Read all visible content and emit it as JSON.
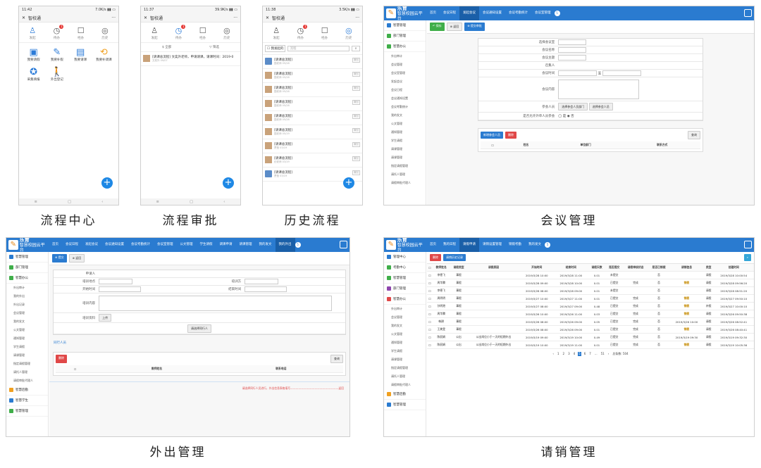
{
  "captions": {
    "p1": "流程中心",
    "p2": "流程审批",
    "p3": "历史流程",
    "p4": "会议管理",
    "p5": "外出管理",
    "p6": "请销管理"
  },
  "phone": {
    "title": "智校通",
    "more": "···",
    "close": "✕",
    "time1": "11:42",
    "time2": "11:37",
    "time3": "11:38",
    "status1": "7.0K/s ▮▮ ▭",
    "status2": "39.9K/s ▮▮ ▭",
    "status3": "3.5K/s ▮▮ ▭",
    "icons": [
      "发起",
      "待办",
      "经办",
      "历史"
    ],
    "badge": "1",
    "apps": [
      "我要请假",
      "我要补假",
      "我要请课",
      "我要补调课",
      "采集填报",
      "外出登记"
    ],
    "filter_all": "全部",
    "filter_sort": "筛选",
    "approval_item": "[请课总流程] 文奕外老师，申请请课，请课时间：2019-0",
    "approval_sub": "文奕外 09/07",
    "check_all": "我发起的",
    "search_ph": "流程",
    "history": [
      {
        "t": "[请课总流程]",
        "s": "国老师 05/28",
        "a": "撤回"
      },
      {
        "t": "[请课总流程]",
        "s": "国老师 05/28",
        "a": "撤回"
      },
      {
        "t": "[请课总流程]",
        "s": "国老师 05/28",
        "a": "撤回"
      },
      {
        "t": "[请课总流程]",
        "s": "国老师 05/28",
        "a": "撤回"
      },
      {
        "t": "[请课总流程]",
        "s": "国老师 05/28",
        "a": "撤回"
      },
      {
        "t": "[请课总流程]",
        "s": "国老师 05/19",
        "a": "撤回"
      },
      {
        "t": "[请课总流程]",
        "s": "贾莹 03/19",
        "a": "撤回"
      },
      {
        "t": "[请课总流程]",
        "s": "纪老师 03/19",
        "a": "撤回"
      },
      {
        "t": "[请课总流程]",
        "s": "贾莹 03/19",
        "a": "撤回"
      }
    ]
  },
  "web": {
    "logo": "乐育",
    "logo_sub": "智慧校园云平台",
    "nav4": [
      "首页",
      "会议日程",
      "发起会议",
      "会议通知设置",
      "会议考勤统计",
      "会议室管理"
    ],
    "nav5": [
      "首页",
      "会议日程",
      "发起会议",
      "会议通知设置",
      "会议考勤统计",
      "会议室管理",
      "公文管理",
      "学生请假",
      "调课申请",
      "请课管理",
      "我的发文",
      "我的外出"
    ],
    "nav6": [
      "首页",
      "我的日程",
      "请假申请",
      "请销设置管理",
      "销假考勤",
      "我的发文"
    ],
    "nav_bubble": "5",
    "side4": [
      "智慧管理",
      "部门管理",
      "智慧办公",
      "外出审计",
      "会议管理",
      "会议室管理",
      "发起会议",
      "会议日程",
      "会议通知设置",
      "会议考勤统计",
      "我的发文",
      "公文管理",
      "通知管理",
      "学生请假",
      "请课管理",
      "请课管理",
      "指定请假管理",
      "请托人管理",
      "请假审批代理人"
    ],
    "toolbar4": {
      "save": "保存",
      "back": "返回",
      "submit": "提交审批"
    },
    "form4": [
      "选择会议室",
      "会议名称",
      "会议主题",
      "召集人",
      "会议时间",
      "会议内容",
      "参会人员",
      "是否允许外单人员参会"
    ],
    "to": "至",
    "pick_dept": "选择参会人员部门",
    "pick_person": "选择参会人员",
    "yes": "是",
    "no": "否",
    "add_btn": "新增参会人员",
    "del_btn": "删除",
    "search_btn": "查询",
    "cols4": [
      "姓名",
      "单位部门",
      "联系方式"
    ],
    "toolbar5": {
      "submit": "提交",
      "back": "返回"
    },
    "form5": [
      "申请人",
      "培训地点",
      "培训方",
      "开始时间",
      "结束时间",
      "培训内容",
      "培训资料"
    ],
    "upload": "上传",
    "choose_fellow": "请选择同行人",
    "fellow_tab": "同行人员",
    "cols5": [
      "教师姓名",
      "联系电话"
    ],
    "footer5": "请选择同行人员进行，外出信息表格填写——————————————————返回",
    "side5": [
      "智慧管理",
      "部门管理",
      "智慧办公",
      "外出审计",
      "我的外出",
      "外出记录",
      "会议管理",
      "我的发文",
      "公文管理",
      "通知管理",
      "学生请假",
      "请课管理",
      "指定请假管理",
      "请托人管理",
      "请假审批代理人",
      "智慧后勤",
      "智慧学生",
      "智慧管理"
    ],
    "side6": [
      "管理中心",
      "考勤中心",
      "智慧管理",
      "部门管理",
      "智慧办公",
      "外出审计",
      "会议管理",
      "我的发文",
      "公文管理",
      "通知管理",
      "学生请假",
      "请课管理",
      "指定请假管理",
      "请托人管理",
      "请假审批代理人",
      "智慧后勤",
      "智慧管理"
    ],
    "toolbar6": {
      "del": "删除",
      "clear": "请销历史记录"
    },
    "cols6": [
      "教师姓名",
      "请假类型",
      "请假原因",
      "开始时间",
      "结束时间",
      "请假天数",
      "是否提交",
      "请假审核状态",
      "是否已销假",
      "请销信息",
      "类型",
      "创建时间"
    ],
    "rows6": [
      [
        "李德飞",
        "事假",
        "",
        "2019/3/28 10:00",
        "2019/3/28 11:00",
        "0.01",
        "未提交",
        "",
        "否",
        "",
        "请假",
        "2019/3/28 10:00:54"
      ],
      [
        "周华腾",
        "事假",
        "",
        "2019/3/28 09:00",
        "2019/3/28 10:00",
        "0.01",
        "已提交",
        "完成",
        "否",
        "销假",
        "请假",
        "2019/3/28 09:56:20"
      ],
      [
        "李德飞",
        "事假",
        "",
        "2019/3/28 08:00",
        "2019/3/28 09:00",
        "0.01",
        "未提交",
        "",
        "否",
        "",
        "请假",
        "2019/3/28 08:51:20"
      ],
      [
        "周明明",
        "事假",
        "",
        "2019/3/27 10:00",
        "2019/3/27 11:00",
        "0.01",
        "已提交",
        "完成",
        "否",
        "销假",
        "请假",
        "2019/3/27 09:50:10"
      ],
      [
        "孙明港",
        "事假",
        "",
        "2019/3/27 08:00",
        "2019/3/27 09:00",
        "0.48",
        "已提交",
        "完成",
        "否",
        "销假",
        "补假",
        "2019/3/27 10:00:10"
      ],
      [
        "周华腾",
        "事假",
        "",
        "2019/3/26 10:00",
        "2019/3/26 11:00",
        "0.03",
        "已提交",
        "完成",
        "否",
        "销假",
        "请假",
        "2019/3/26 09:50:38"
      ],
      [
        "韩耕",
        "事假",
        "",
        "2019/3/26 08:00",
        "2019/3/26 09:00",
        "0.05",
        "已提交",
        "完成",
        "否",
        "2019/3/26 10:00",
        "请假",
        "2019/3/26 08:52:41"
      ],
      [
        "王美雯",
        "事假",
        "",
        "2019/3/26 08:00",
        "2019/3/26 09:00",
        "0.01",
        "已提交",
        "完成",
        "否",
        "销假",
        "请假",
        "2019/3/26 08:40:41"
      ],
      [
        "陈丽娟",
        "公出",
        "公出岗位小于一天的短期外出",
        "2019/3/19 09:00",
        "2019/3/19 10:00",
        "0.49",
        "已提交",
        "完成",
        "否",
        "2019/3/19 09:30",
        "请假",
        "2019/3/19 09:32:30"
      ],
      [
        "陈丽娟",
        "公出",
        "公出岗位小于一天的短期外出",
        "2019/3/19 10:00",
        "2019/3/19 11:00",
        "0.01",
        "已提交",
        "完成",
        "否",
        "销假",
        "请假",
        "2019/3/19 10:05:36"
      ]
    ],
    "pager": [
      "‹",
      "1",
      "2",
      "3",
      "4",
      "5",
      "6",
      "7",
      "...",
      "51",
      "›"
    ],
    "pager_total": "总条数: 504"
  }
}
